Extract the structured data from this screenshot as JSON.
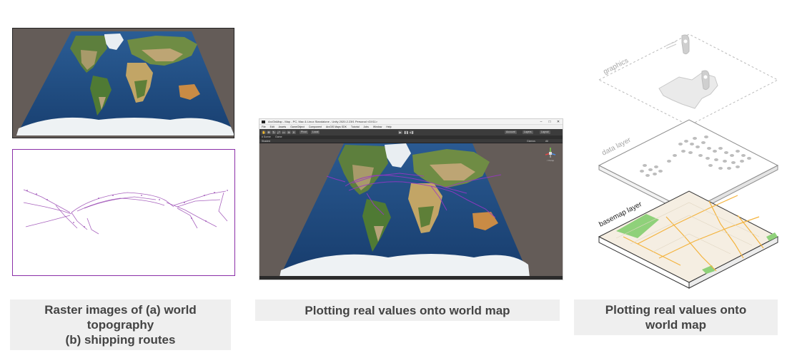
{
  "captions": {
    "raster": {
      "line1": "Raster images of (a) world",
      "line2": "topography",
      "line3": "(b) shipping routes"
    },
    "plotting_center": "Plotting real values onto world map",
    "plotting_right": {
      "line1": "Plotting real values onto",
      "line2": "world map"
    }
  },
  "unity": {
    "title": "ArcGisMap - Map - PC, Mac & Linux Standalone - Unity 2020.2.23f1 Personal <DX11>",
    "menu": [
      "File",
      "Edit",
      "Assets",
      "GameObject",
      "Component",
      "ArcGIS Maps SDK",
      "Tutorial",
      "Jobs",
      "Window",
      "Help"
    ],
    "toolbar": {
      "pivot": "Pivot",
      "local": "Local",
      "account": "Account",
      "layers": "Layers",
      "layout": "Layout"
    },
    "tabs": {
      "scene": "# Scene",
      "game": "Game"
    },
    "scenebar": {
      "shaded": "Shaded",
      "gizmos": "Gizmos",
      "all": "All"
    },
    "gizmo_label": "< Persp",
    "window_buttons": [
      "–",
      "□",
      "✕"
    ]
  },
  "layers": {
    "graphics": "graphics",
    "data": "data layer",
    "basemap": "basemap layer"
  },
  "colors": {
    "frame_bg": "#645c58",
    "route_purple": "#8b2fa8",
    "caption_bg": "#efefef",
    "caption_text": "#444444",
    "road_orange": "#f4b33d",
    "park_green": "#8fd17a",
    "ocean": "#1f4f86",
    "land": "#c9b88a"
  },
  "icons": [
    "app-icon",
    "play-icon",
    "pause-icon",
    "step-icon",
    "scene-gizmo-icon",
    "map-pin-icon"
  ]
}
